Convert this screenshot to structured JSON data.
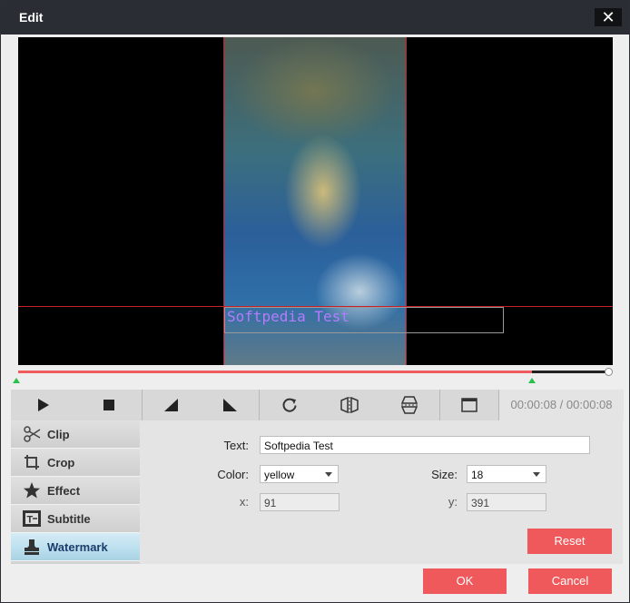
{
  "window": {
    "title": "Edit",
    "close_glyph": "✕"
  },
  "preview": {
    "watermark_text": "Softpedia Test"
  },
  "toolbar": {
    "buttons": [
      {
        "name": "play",
        "icon": "play-icon"
      },
      {
        "name": "stop",
        "icon": "stop-icon"
      },
      {
        "name": "set-start",
        "icon": "set-start-icon"
      },
      {
        "name": "set-end",
        "icon": "set-end-icon"
      },
      {
        "name": "rotate",
        "icon": "rotate-icon"
      },
      {
        "name": "flip-horizontal",
        "icon": "flip-horizontal-icon"
      },
      {
        "name": "flip-vertical",
        "icon": "flip-vertical-icon"
      },
      {
        "name": "fullscreen",
        "icon": "fullscreen-icon"
      }
    ],
    "time_display": "00:00:08 / 00:00:08"
  },
  "timeline": {
    "progress": 0.87
  },
  "sidenav": {
    "items": [
      {
        "label": "Clip",
        "icon": "scissors-icon"
      },
      {
        "label": "Crop",
        "icon": "crop-icon"
      },
      {
        "label": "Effect",
        "icon": "star-icon"
      },
      {
        "label": "Subtitle",
        "icon": "subtitle-icon"
      },
      {
        "label": "Watermark",
        "icon": "watermark-icon",
        "active": true
      }
    ]
  },
  "form": {
    "text_label": "Text:",
    "text_value": "Softpedia Test",
    "color_label": "Color:",
    "color_value": "yellow",
    "size_label": "Size:",
    "size_value": "18",
    "x_label": "x:",
    "x_value": "91",
    "y_label": "y:",
    "y_value": "391",
    "reset_label": "Reset"
  },
  "footer": {
    "ok_label": "OK",
    "cancel_label": "Cancel"
  },
  "colors": {
    "accent": "#f0595b",
    "titlebar": "#2a2d33",
    "active_tab": "#bfe1ef",
    "watermark_text": "#b57bff"
  }
}
